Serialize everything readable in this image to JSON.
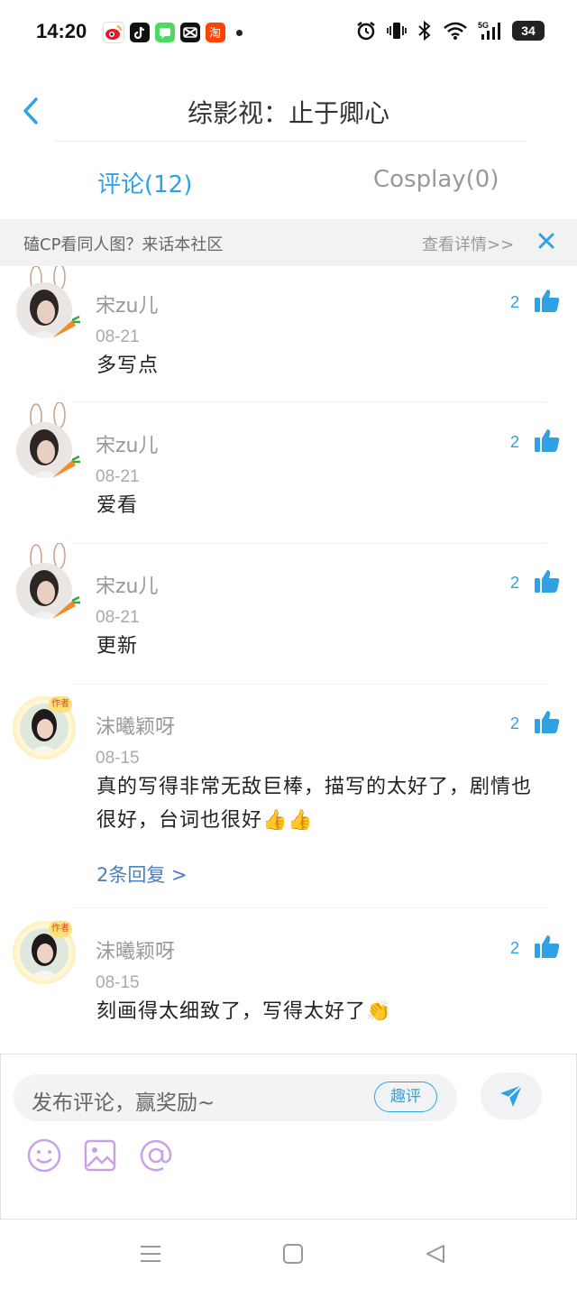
{
  "status_bar": {
    "time": "14:20",
    "battery": "34",
    "app_icons": [
      "weibo-icon",
      "tiktok-icon",
      "messages-icon",
      "capcut-icon",
      "taobao-icon"
    ],
    "system_icons": [
      "alarm-icon",
      "vibrate-icon",
      "bluetooth-icon",
      "wifi-icon",
      "5g-signal-icon",
      "battery-icon"
    ]
  },
  "header": {
    "title": "综影视：止于卿心"
  },
  "tabs": [
    {
      "label": "评论(12)",
      "active": true
    },
    {
      "label": "Cosplay(0)",
      "active": false
    }
  ],
  "banner": {
    "text": "磕CP看同人图？来话本社区",
    "link": "查看详情>>"
  },
  "comments": [
    {
      "user": "宋zu儿",
      "date": "08-21",
      "text": "多写点",
      "likes": "2"
    },
    {
      "user": "宋zu儿",
      "date": "08-21",
      "text": "爱看",
      "likes": "2"
    },
    {
      "user": "宋zu儿",
      "date": "08-21",
      "text": "更新",
      "likes": "2"
    },
    {
      "user": "沫曦颖呀",
      "date": "08-15",
      "text": "真的写得非常无敌巨棒，描写的太好了，剧情也很好，台词也很好👍👍",
      "likes": "2",
      "replies": "2条回复 >",
      "badge": "作者"
    },
    {
      "user": "沫曦颖呀",
      "date": "08-15",
      "text": "刻画得太细致了，写得太好了👏",
      "likes": "2",
      "badge": "作者"
    }
  ],
  "composer": {
    "placeholder": "发布评论，赢奖励~",
    "fun_button": "趣评",
    "tools": [
      "emoji-icon",
      "image-icon",
      "mention-icon"
    ]
  },
  "colors": {
    "accent": "#2fa2e6",
    "link": "#4a80c6",
    "tool": "#c9a2e6"
  }
}
